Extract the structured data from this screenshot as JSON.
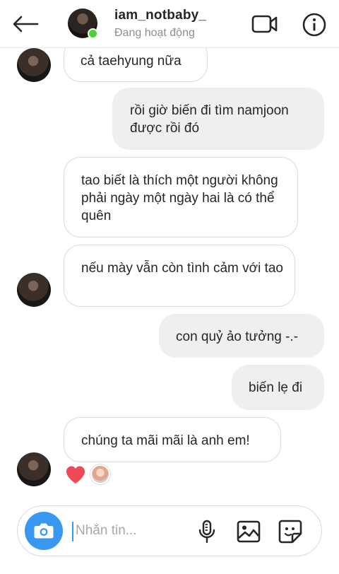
{
  "header": {
    "username": "iam_notbaby_",
    "status": "Đang hoạt động",
    "back_icon": "arrow-left",
    "video_icon": "video-camera",
    "info_icon": "info-circle",
    "online_color": "#4cd137"
  },
  "messages": [
    {
      "direction": "in",
      "text": "cả taehyung nữa"
    },
    {
      "direction": "out",
      "text": "rồi giờ biến đi tìm namjoon được rồi đó"
    },
    {
      "direction": "in",
      "text": "tao biết là thích một người không phải ngày một ngày hai là có thể quên"
    },
    {
      "direction": "in",
      "text": "nếu mày vẫn còn tình cảm với tao"
    },
    {
      "direction": "out",
      "text": "con quỷ ảo tưởng -.-"
    },
    {
      "direction": "out",
      "text": "biến lẹ đi"
    },
    {
      "direction": "in",
      "text": "chúng ta mãi mãi là anh em!"
    }
  ],
  "reaction": {
    "icon": "heart",
    "color": "#ed4956"
  },
  "composer": {
    "placeholder": "Nhắn tin...",
    "value": "",
    "camera_icon": "camera",
    "mic_icon": "microphone",
    "gallery_icon": "image",
    "sticker_icon": "sticker",
    "accent": "#3897f0"
  },
  "colors": {
    "incoming_bg": "#ffffff",
    "outgoing_bg": "#efefef",
    "text": "#262626",
    "muted": "#8e8e8e"
  }
}
